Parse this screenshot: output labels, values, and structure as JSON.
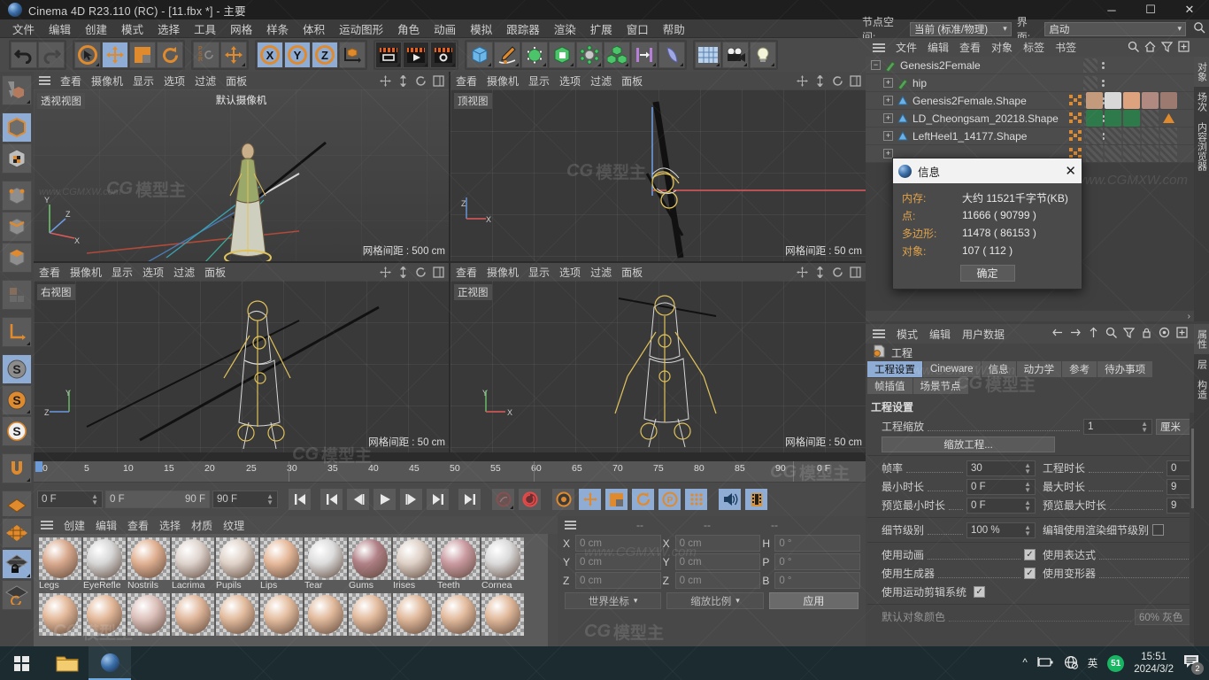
{
  "window": {
    "title": "Cinema 4D R23.110 (RC) - [11.fbx *] - 主要",
    "minimize": "─",
    "maximize": "☐",
    "close": "✕"
  },
  "menubar": [
    "文件",
    "编辑",
    "创建",
    "模式",
    "选择",
    "工具",
    "网格",
    "样条",
    "体积",
    "运动图形",
    "角色",
    "动画",
    "模拟",
    "跟踪器",
    "渲染",
    "扩展",
    "窗口",
    "帮助"
  ],
  "topright": {
    "nodespace_label": "节点空间:",
    "nodespace_value": "当前 (标准/物理)",
    "interface_label": "界面:",
    "interface_value": "启动"
  },
  "viewports": [
    {
      "label": "透视视图",
      "camera": "默认摄像机",
      "grid": "网格间距 : 500 cm",
      "menu": [
        "查看",
        "摄像机",
        "显示",
        "选项",
        "过滤",
        "面板"
      ]
    },
    {
      "label": "顶视图",
      "camera": "",
      "grid": "网格间距 : 50 cm",
      "menu": [
        "查看",
        "摄像机",
        "显示",
        "选项",
        "过滤",
        "面板"
      ]
    },
    {
      "label": "右视图",
      "camera": "",
      "grid": "网格间距 : 50 cm",
      "menu": [
        "查看",
        "摄像机",
        "显示",
        "选项",
        "过滤",
        "面板"
      ]
    },
    {
      "label": "正视图",
      "camera": "",
      "grid": "网格间距 : 50 cm",
      "menu": [
        "查看",
        "摄像机",
        "显示",
        "选项",
        "过滤",
        "面板"
      ]
    }
  ],
  "timeline": {
    "ticks": [
      "0",
      "5",
      "10",
      "15",
      "20",
      "25",
      "30",
      "35",
      "40",
      "45",
      "50",
      "55",
      "60",
      "65",
      "70",
      "75",
      "80",
      "85",
      "90"
    ],
    "current_frame": "0 F",
    "start_field": "0 F",
    "range_start": "0 F",
    "range_end": "90 F",
    "end_field": "90 F"
  },
  "material_manager": {
    "menu": [
      "创建",
      "编辑",
      "查看",
      "选择",
      "材质",
      "纹理"
    ],
    "row1": [
      {
        "name": "Legs",
        "color": "#d8a98d"
      },
      {
        "name": "EyeRefle",
        "color": "#d6d6d6"
      },
      {
        "name": "Nostrils",
        "color": "#e0b091"
      },
      {
        "name": "Lacrima",
        "color": "#ded3cd"
      },
      {
        "name": "Pupils",
        "color": "#dfd2c8"
      },
      {
        "name": "Lips",
        "color": "#e6b99a"
      },
      {
        "name": "Tear",
        "color": "#dcdcdc"
      },
      {
        "name": "Gums",
        "color": "#b08086"
      },
      {
        "name": "Irises",
        "color": "#ded0c6"
      },
      {
        "name": "Teeth",
        "color": "#c99aa0"
      },
      {
        "name": "Cornea",
        "color": "#dadada"
      }
    ],
    "row2": [
      {
        "name": "",
        "color": "#e3b899"
      },
      {
        "name": "",
        "color": "#e3b899"
      },
      {
        "name": "",
        "color": "#dcc0ba"
      },
      {
        "name": "",
        "color": "#e0b79b"
      },
      {
        "name": "",
        "color": "#e2bb9d"
      },
      {
        "name": "",
        "color": "#e4bd9f"
      },
      {
        "name": "",
        "color": "#e1b99b"
      },
      {
        "name": "",
        "color": "#e2ba9c"
      },
      {
        "name": "",
        "color": "#e0b89a"
      },
      {
        "name": "",
        "color": "#e2ba9c"
      },
      {
        "name": "",
        "color": "#e1b99b"
      }
    ]
  },
  "coordinates": {
    "header": [
      "--",
      "--",
      "--"
    ],
    "rows": [
      {
        "k1": "X",
        "v1": "0 cm",
        "k2": "X",
        "v2": "0 cm",
        "k3": "H",
        "v3": "0 °"
      },
      {
        "k1": "Y",
        "v1": "0 cm",
        "k2": "Y",
        "v2": "0 cm",
        "k3": "P",
        "v3": "0 °"
      },
      {
        "k1": "Z",
        "v1": "0 cm",
        "k2": "Z",
        "v2": "0 cm",
        "k3": "B",
        "v3": "0 °"
      }
    ],
    "coord_system": "世界坐标",
    "scale_mode": "缩放比例",
    "apply": "应用"
  },
  "object_manager": {
    "menu": [
      "文件",
      "编辑",
      "查看",
      "对象",
      "标签",
      "书签"
    ],
    "items": [
      {
        "name": "Genesis2Female",
        "depth": 0,
        "icon": "null-icon",
        "tags": "none"
      },
      {
        "name": "hip",
        "depth": 1,
        "icon": "null-icon",
        "tags": "none"
      },
      {
        "name": "Genesis2Female.Shape",
        "depth": 1,
        "icon": "mesh-icon",
        "tags": "skin"
      },
      {
        "name": "LD_Cheongsam_20218.Shape",
        "depth": 1,
        "icon": "mesh-icon",
        "tags": "green"
      },
      {
        "name": "LeftHeel1_14177.Shape",
        "depth": 1,
        "icon": "mesh-icon",
        "tags": "empty"
      }
    ],
    "vtabs": [
      "对象",
      "场次",
      "内容浏览器"
    ]
  },
  "attribute_manager": {
    "menu": [
      "模式",
      "编辑",
      "用户数据"
    ],
    "object_title": "工程",
    "tabs_row1": [
      "工程设置",
      "Cineware",
      "信息",
      "动力学",
      "参考",
      "待办事项"
    ],
    "tabs_row2": [
      "帧插值",
      "场景节点"
    ],
    "active_tab": "工程设置",
    "section_title": "工程设置",
    "project_scale_label": "工程缩放",
    "project_scale_value": "1",
    "project_scale_unit": "厘米",
    "scale_project_button": "缩放工程...",
    "fields": [
      {
        "l": "帧率",
        "v": "30",
        "rl": "工程时长",
        "rv": "0"
      },
      {
        "l": "最小时长",
        "v": "0 F",
        "rl": "最大时长",
        "rv": "9"
      },
      {
        "l": "预览最小时长",
        "v": "0 F",
        "rl": "预览最大时长",
        "rv": "9"
      }
    ],
    "lod_label": "细节级别",
    "lod_value": "100 %",
    "lod_right_label": "编辑使用渲染细节级别",
    "checks": [
      {
        "l": "使用动画",
        "c": true,
        "rl": "使用表达式",
        "rc": true
      },
      {
        "l": "使用生成器",
        "c": true,
        "rl": "使用变形器",
        "rc": true
      },
      {
        "l": "使用运动剪辑系统",
        "c": true,
        "rl": "",
        "rc": null
      }
    ],
    "bottom_label": "默认对象颜色",
    "bottom_value": "60% 灰色",
    "vtabs": [
      "属性",
      "层",
      "构造"
    ]
  },
  "dialog": {
    "title": "信息",
    "close": "✕",
    "rows": [
      {
        "k": "内存:",
        "v": "大约 11521千字节(KB)"
      },
      {
        "k": "点:",
        "v": "11666 ( 90799 )"
      },
      {
        "k": "多边形:",
        "v": "11478 ( 86153 )"
      },
      {
        "k": "对象:",
        "v": "107 ( 112 )"
      }
    ],
    "ok": "确定"
  },
  "taskbar": {
    "time": "15:51",
    "date": "2024/3/2",
    "lang": "英",
    "badge": "51",
    "notification_count": "2"
  },
  "watermark": {
    "cg": "CG",
    "cn": "模型主",
    "url": "www.CGMXW.com"
  },
  "colors": {
    "accent": "#e08a2e",
    "selected": "#8fadd4",
    "bg": "#414141",
    "panel": "#4a4a4a"
  }
}
